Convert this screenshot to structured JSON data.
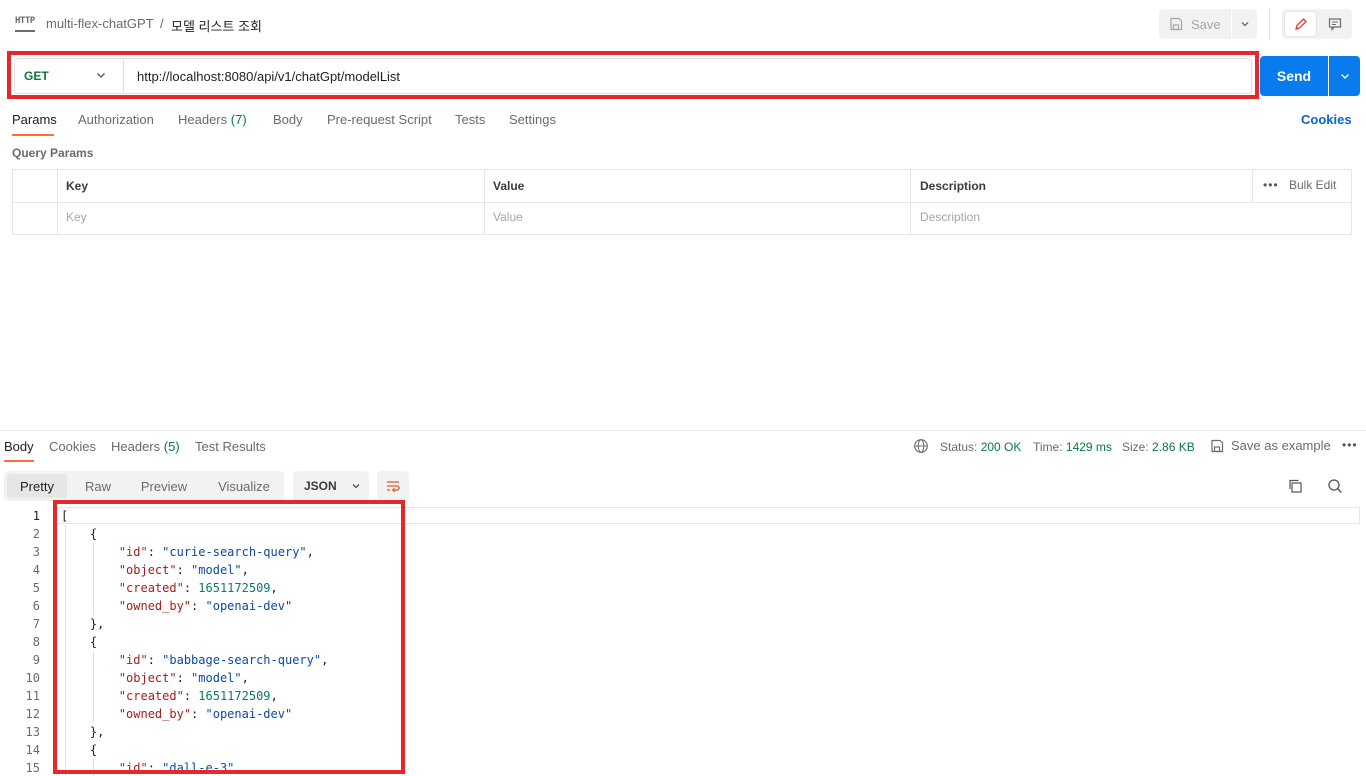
{
  "header": {
    "http_icon": "HTTP",
    "breadcrumb_parent": "multi-flex-chatGPT",
    "breadcrumb_sep": "/",
    "breadcrumb_current": "모델 리스트 조회",
    "save_label": "Save"
  },
  "request": {
    "method": "GET",
    "url": "http://localhost:8080/api/v1/chatGpt/modelList",
    "send_label": "Send",
    "tabs": {
      "params": "Params",
      "authorization": "Authorization",
      "headers": "Headers",
      "headers_count": "(7)",
      "body": "Body",
      "prerequest": "Pre-request Script",
      "tests": "Tests",
      "settings": "Settings"
    },
    "cookies_label": "Cookies",
    "query_params_title": "Query Params",
    "table": {
      "key_header": "Key",
      "value_header": "Value",
      "description_header": "Description",
      "bulk_edit": "Bulk Edit",
      "more": "•••",
      "key_placeholder": "Key",
      "value_placeholder": "Value",
      "description_placeholder": "Description"
    }
  },
  "response": {
    "tabs": {
      "body": "Body",
      "cookies": "Cookies",
      "headers": "Headers",
      "headers_count": "(5)",
      "test_results": "Test Results"
    },
    "status_label": "Status:",
    "status_value": "200 OK",
    "time_label": "Time:",
    "time_value": "1429 ms",
    "size_label": "Size:",
    "size_value": "2.86 KB",
    "save_example": "Save as example",
    "more": "•••",
    "views": {
      "pretty": "Pretty",
      "raw": "Raw",
      "preview": "Preview",
      "visualize": "Visualize"
    },
    "format": "JSON",
    "code_lines": [
      {
        "n": "1",
        "text": "["
      },
      {
        "n": "2",
        "text": "    {"
      },
      {
        "n": "3",
        "key": "\"id\"",
        "val": "\"curie-search-query\"",
        "type": "s"
      },
      {
        "n": "4",
        "key": "\"object\"",
        "val": "\"model\"",
        "type": "s"
      },
      {
        "n": "5",
        "key": "\"created\"",
        "val": "1651172509",
        "type": "n"
      },
      {
        "n": "6",
        "key": "\"owned_by\"",
        "val": "\"openai-dev\"",
        "type": "s",
        "last": true
      },
      {
        "n": "7",
        "text": "    },"
      },
      {
        "n": "8",
        "text": "    {"
      },
      {
        "n": "9",
        "key": "\"id\"",
        "val": "\"babbage-search-query\"",
        "type": "s"
      },
      {
        "n": "10",
        "key": "\"object\"",
        "val": "\"model\"",
        "type": "s"
      },
      {
        "n": "11",
        "key": "\"created\"",
        "val": "1651172509",
        "type": "n"
      },
      {
        "n": "12",
        "key": "\"owned_by\"",
        "val": "\"openai-dev\"",
        "type": "s",
        "last": true
      },
      {
        "n": "13",
        "text": "    },"
      },
      {
        "n": "14",
        "text": "    {"
      },
      {
        "n": "15",
        "key": "\"id\"",
        "val": "\"dall-e-3\"",
        "type": "s"
      }
    ]
  }
}
